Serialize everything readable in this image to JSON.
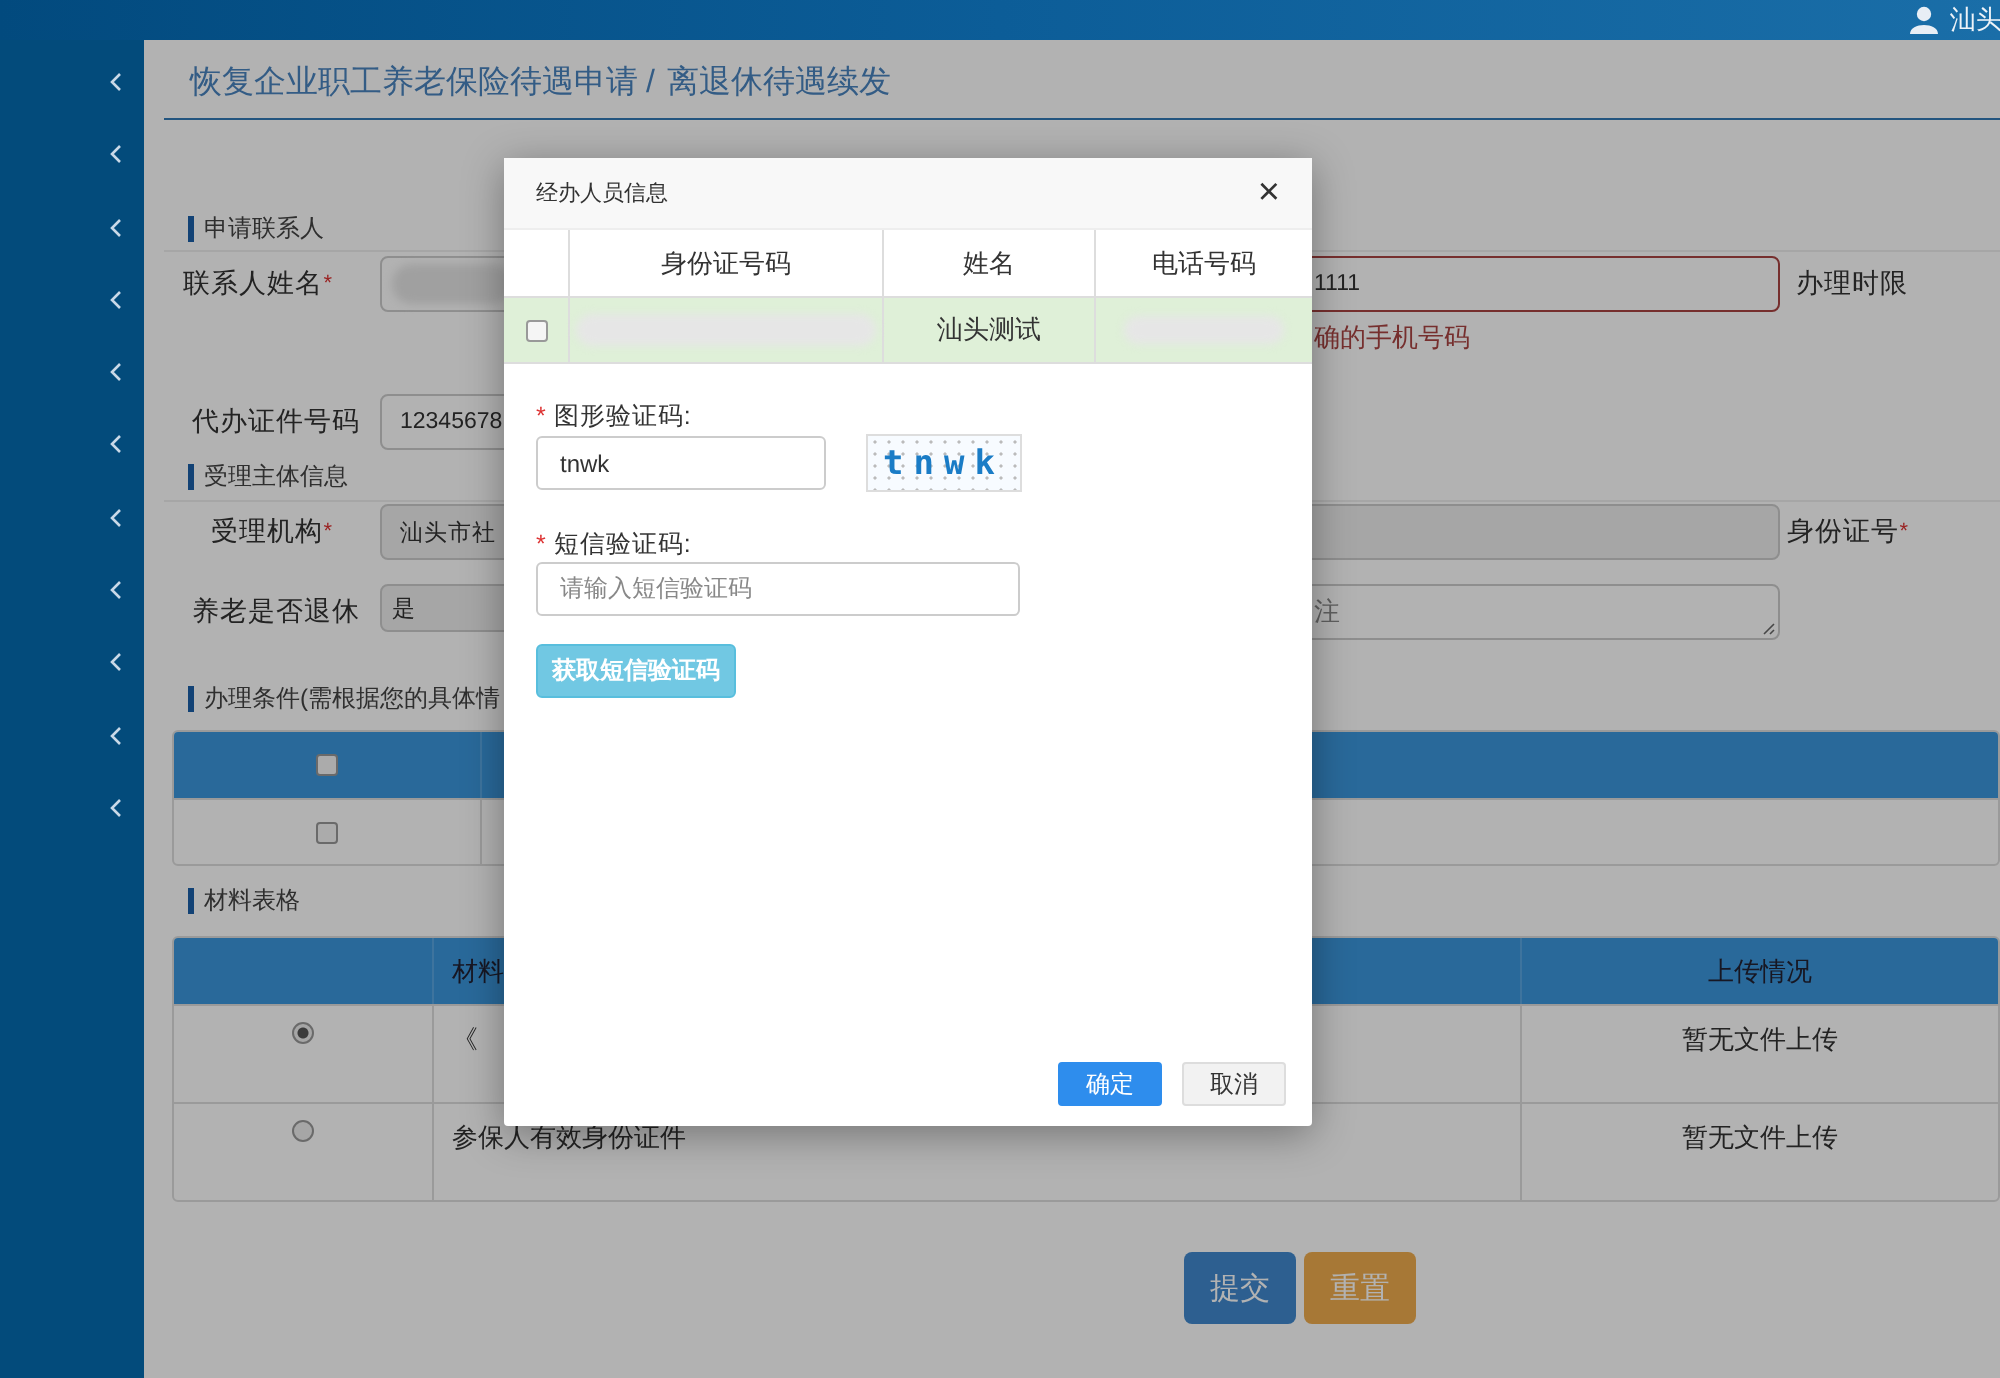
{
  "top_bar": {
    "user_name": "汕头"
  },
  "sidebar": {
    "items": [
      {
        "expanded": false
      },
      {
        "expanded": false
      },
      {
        "expanded": false
      },
      {
        "expanded": false
      },
      {
        "expanded": false
      },
      {
        "expanded": false
      },
      {
        "expanded": false
      },
      {
        "expanded": false
      },
      {
        "expanded": false
      },
      {
        "expanded": false
      },
      {
        "expanded": false
      }
    ]
  },
  "breadcrumb": {
    "items": [
      "恢复企业职工养老保险待遇申请",
      "离退休待遇续发"
    ],
    "separator": "/"
  },
  "sections": [
    {
      "title": "申请联系人",
      "rows": [
        {
          "cells": [
            {
              "kind": "label",
              "text": "联系人姓名",
              "required_mark": "*"
            },
            {
              "kind": "field",
              "redacted": true
            },
            {
              "kind": "field",
              "value": "1111",
              "invalid": true,
              "error": "确的手机号码"
            },
            {
              "kind": "label",
              "text": "办理时限"
            }
          ]
        },
        {
          "cells": [
            {
              "kind": "label",
              "text": "代办证件号码"
            },
            {
              "kind": "field",
              "value": "12345678"
            }
          ]
        }
      ]
    },
    {
      "title": "受理主体信息",
      "rows": [
        {
          "cells": [
            {
              "kind": "label",
              "text": "受理机构",
              "required_mark": "*"
            },
            {
              "kind": "field",
              "value": "汕头市社",
              "disabled": true
            },
            {
              "kind": "field",
              "disabled": true
            },
            {
              "kind": "label",
              "text": "身份证号",
              "required_mark": "*"
            }
          ]
        },
        {
          "cells": [
            {
              "kind": "label",
              "text": "养老是否退休"
            },
            {
              "kind": "field",
              "value": "是",
              "disabled": true
            },
            {
              "kind": "textarea",
              "placeholder": "注"
            }
          ]
        }
      ]
    },
    {
      "title": "办理条件(需根据您的具体情",
      "table": {
        "kind": "conditions",
        "header_checked": false,
        "rows": [
          {
            "checked": false
          }
        ]
      }
    },
    {
      "title": "材料表格",
      "table": {
        "kind": "materials",
        "columns": [
          "材料",
          "上传情况"
        ],
        "rows": [
          {
            "selected": true,
            "material": "《",
            "upload_status": "暂无文件上传"
          },
          {
            "selected": false,
            "material": "参保人有效身份证件",
            "upload_status": "暂无文件上传"
          }
        ]
      }
    }
  ],
  "actions": [
    {
      "label": "提交",
      "kind": "primary"
    },
    {
      "label": "重置",
      "kind": "warning"
    }
  ],
  "dialog": {
    "title": "经办人员信息",
    "close": "×",
    "table": {
      "columns": [
        "身份证号码",
        "姓名",
        "电话号码"
      ],
      "rows": [
        {
          "checked": false,
          "highlighted": true,
          "id_redacted": true,
          "name": "汕头测试",
          "phone_redacted": true
        }
      ]
    },
    "fields": [
      {
        "label": "图形验证码:",
        "required_mark": "*",
        "value": "tnwk",
        "captcha": "tnwk"
      },
      {
        "label": "短信验证码:",
        "required_mark": "*",
        "placeholder": "请输入短信验证码"
      }
    ],
    "sms_button": {
      "label": "获取短信验证码",
      "disabled": true
    },
    "buttons": [
      {
        "label": "确定",
        "kind": "primary"
      },
      {
        "label": "取消",
        "kind": "default"
      }
    ]
  }
}
